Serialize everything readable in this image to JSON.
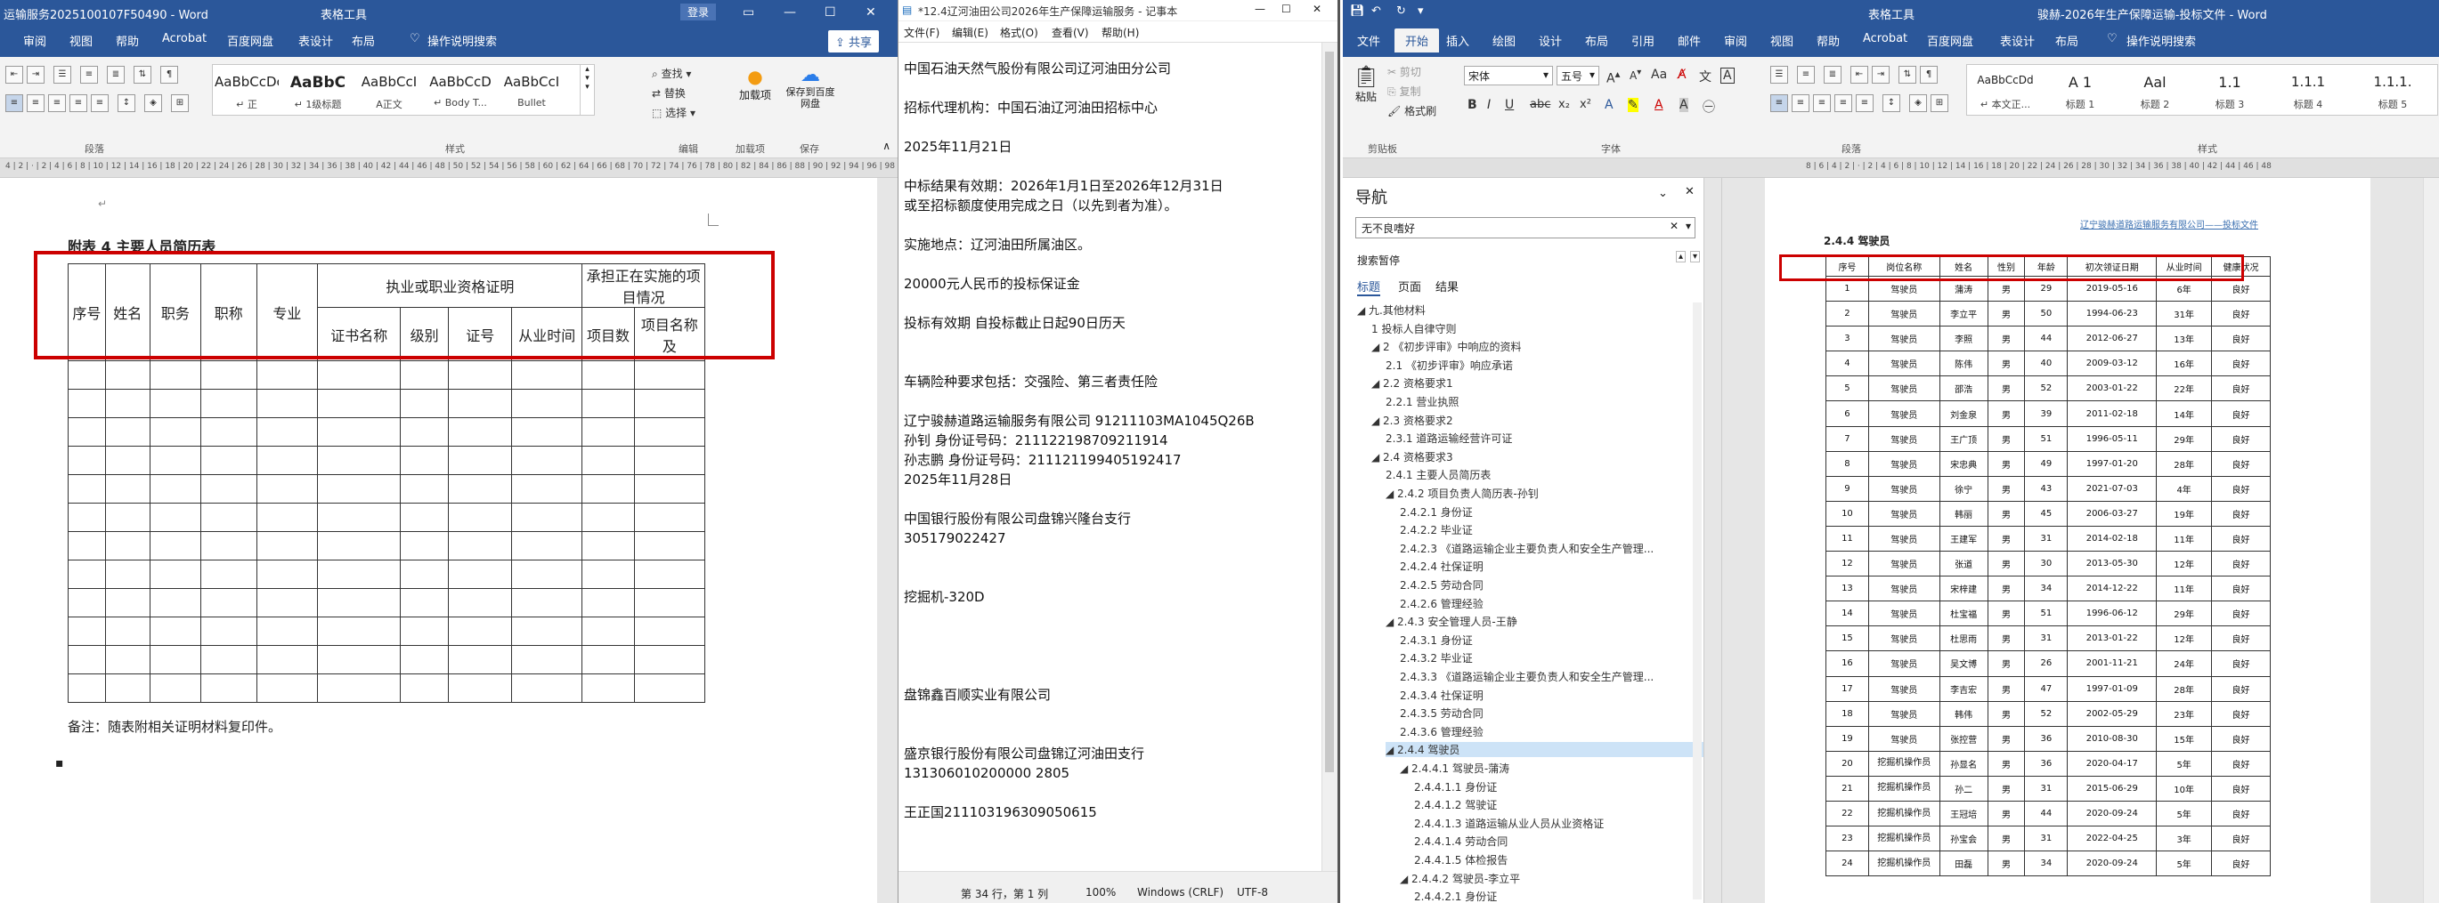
{
  "w1": {
    "title": "运输服务20251001­07F50490  -  Word",
    "title_short": "运输服务2025100107F50490 - Word",
    "tool_label": "表格工具",
    "login": "登录",
    "tabs": [
      "审阅",
      "视图",
      "帮助",
      "Acrobat",
      "百度网盘",
      "表设计",
      "布局"
    ],
    "tell_me": "操作说明搜索",
    "share": "共享",
    "styles": [
      {
        "sample": "AaBbCcDc",
        "name": "↵ 正"
      },
      {
        "sample": "AaBbC",
        "name": "↵ 1级标题"
      },
      {
        "sample": "AaBbCcI",
        "name": "A正文"
      },
      {
        "sample": "AaBbCcD",
        "name": "↵ Body T..."
      },
      {
        "sample": "AaBbCcI",
        "name": "Bullet"
      }
    ],
    "edit": {
      "find": "查找",
      "replace": "替换",
      "select": "选择"
    },
    "addin": "加载项",
    "save_baidu": "保存到百度网盘",
    "groups": {
      "para": "段落",
      "styles": "样式",
      "edit": "编辑",
      "addin": "加载项",
      "save": "保存"
    },
    "doc": {
      "caption": "附表 4  主要人员简历表",
      "headers": {
        "no": "序号",
        "name": "姓名",
        "post": "职务",
        "title": "职称",
        "major": "专业",
        "cert_group": "执业或职业资格证明",
        "cert_name": "证书名称",
        "level": "级别",
        "cert_no": "证号",
        "years": "从业时间",
        "proj_group": "承担正在实施的项目情况",
        "proj_count": "项目数",
        "proj_name": "项目名称及"
      },
      "note": "备注：随表附相关证明材料复印件。",
      "bullet": "▪"
    }
  },
  "w2": {
    "title": "*12.4辽河油田公司2026年生产保障运输服务 - 记事本",
    "menu": [
      "文件(F)",
      "编辑(E)",
      "格式(O)",
      "查看(V)",
      "帮助(H)"
    ],
    "lines": [
      "中国石油天然气股份有限公司辽河油田分公司",
      "",
      "招标代理机构：中国石油辽河油田招标中心",
      "",
      "2025年11月21日",
      "",
      "中标结果有效期：2026年1月1日至2026年12月31日",
      "或至招标额度使用完成之日（以先到者为准）。",
      "",
      "实施地点：辽河油田所属油区。",
      "",
      "20000元人民币的投标保证金",
      "",
      "投标有效期  自投标截止日起90日历天",
      "",
      "",
      "车辆险种要求包括：交强险、第三者责任险",
      "",
      "辽宁骏赫道路运输服务有限公司    91211103MA1045Q26B",
      "孙钊       身份证号码：211122198709211914",
      "孙志鹏     身份证号码：211121199405192417",
      "2025年11月28日",
      "",
      "中国银行股份有限公司盘锦兴隆台支行",
      "305179022427",
      "",
      "",
      "挖掘机-320D",
      "",
      "",
      "",
      "",
      "盘锦鑫百顺实业有限公司",
      "",
      "",
      "盛京银行股份有限公司盘锦辽河油田支行",
      "131306010200000 2805",
      "",
      "王正国211103196309050615"
    ],
    "status": {
      "pos": "第 34 行，第 1 列",
      "zoom": "100%",
      "eol": "Windows (CRLF)",
      "enc": "UTF-8"
    }
  },
  "w3": {
    "title": "骏赫-2026年生产保障运输-投标文件 - Word",
    "tool_label": "表格工具",
    "tabs": [
      "文件",
      "开始",
      "插入",
      "绘图",
      "设计",
      "布局",
      "引用",
      "邮件",
      "审阅",
      "视图",
      "帮助",
      "Acrobat",
      "百度网盘",
      "表设计",
      "布局"
    ],
    "tell_me": "操作说明搜索",
    "clipboard": {
      "paste": "粘贴",
      "cut": "剪切",
      "copy": "复制",
      "painter": "格式刷",
      "group": "剪贴板"
    },
    "font": {
      "name": "宋体",
      "size": "五号",
      "group": "字体"
    },
    "groups": {
      "para": "段落",
      "styles": "样式"
    },
    "styles": [
      {
        "sample": "AaBbCcDd",
        "name": "↵ 本文正..."
      },
      {
        "sample": "A 1",
        "name": "标题 1"
      },
      {
        "sample": "Aal",
        "name": "标题 2"
      },
      {
        "sample": "1.1",
        "name": "标题 3"
      },
      {
        "sample": "1.1.1",
        "name": "标题 4"
      },
      {
        "sample": "1.1.1.",
        "name": "标题 5"
      }
    ],
    "nav": {
      "title": "导航",
      "search_value": "无不良嗜好",
      "search_pause": "搜索暂停",
      "tabs": [
        "标题",
        "页面",
        "结果"
      ],
      "items": [
        "◢ 九.其他材料",
        "1 投标人自律守则",
        "◢ 2 《初步评审》中响应的资料",
        "2.1 《初步评审》响应承诺",
        "◢ 2.2 资格要求1",
        "2.2.1 营业执照",
        "◢ 2.3 资格要求2",
        "2.3.1 道路运输经营许可证",
        "◢ 2.4 资格要求3",
        "2.4.1 主要人员简历表",
        "◢ 2.4.2 项目负责人简历表-孙钊",
        "2.4.2.1 身份证",
        "2.4.2.2 毕业证",
        "2.4.2.3 《道路运输企业主要负责人和安全生产管理...",
        "2.4.2.4 社保证明",
        "2.4.2.5 劳动合同",
        "2.4.2.6 管理经验",
        "◢ 2.4.3 安全管理人员-王静",
        "2.4.3.1 身份证",
        "2.4.3.2 毕业证",
        "2.4.3.3 《道路运输企业主要负责人和安全生产管理...",
        "2.4.3.4 社保证明",
        "2.4.3.5 劳动合同",
        "2.4.3.6 管理经验",
        "◢ 2.4.4 驾驶员",
        "◢ 2.4.4.1 驾驶员-蒲涛",
        "2.4.4.1.1 身份证",
        "2.4.4.1.2 驾驶证",
        "2.4.4.1.3 道路运输从业人员从业资格证",
        "2.4.4.1.4 劳动合同",
        "2.4.4.1.5 体检报告",
        "◢ 2.4.4.2 驾驶员-李立平",
        "2.4.4.2.1 身份证"
      ]
    },
    "doc": {
      "header_text": "辽宁骏赫道路运输服务有限公司——投标文件",
      "heading": "2.4.4 驾驶员",
      "cols": [
        "序号",
        "岗位名称",
        "姓名",
        "性别",
        "年龄",
        "初次领证日期",
        "从业时间",
        "健康状况"
      ],
      "rows": [
        [
          "1",
          "驾驶员",
          "蒲涛",
          "男",
          "29",
          "2019-05-16",
          "6年",
          "良好"
        ],
        [
          "2",
          "驾驶员",
          "李立平",
          "男",
          "50",
          "1994-06-23",
          "31年",
          "良好"
        ],
        [
          "3",
          "驾驶员",
          "李照",
          "男",
          "44",
          "2012-06-27",
          "13年",
          "良好"
        ],
        [
          "4",
          "驾驶员",
          "陈伟",
          "男",
          "40",
          "2009-03-12",
          "16年",
          "良好"
        ],
        [
          "5",
          "驾驶员",
          "邵浩",
          "男",
          "52",
          "2003-01-22",
          "22年",
          "良好"
        ],
        [
          "6",
          "驾驶员",
          "刘金泉",
          "男",
          "39",
          "2011-02-18",
          "14年",
          "良好"
        ],
        [
          "7",
          "驾驶员",
          "王广顶",
          "男",
          "51",
          "1996-05-11",
          "29年",
          "良好"
        ],
        [
          "8",
          "驾驶员",
          "宋忠典",
          "男",
          "49",
          "1997-01-20",
          "28年",
          "良好"
        ],
        [
          "9",
          "驾驶员",
          "徐宁",
          "男",
          "43",
          "2021-07-03",
          "4年",
          "良好"
        ],
        [
          "10",
          "驾驶员",
          "韩丽",
          "男",
          "45",
          "2006-03-27",
          "19年",
          "良好"
        ],
        [
          "11",
          "驾驶员",
          "王建军",
          "男",
          "31",
          "2014-02-18",
          "11年",
          "良好"
        ],
        [
          "12",
          "驾驶员",
          "张道",
          "男",
          "30",
          "2013-05-30",
          "12年",
          "良好"
        ],
        [
          "13",
          "驾驶员",
          "宋梓建",
          "男",
          "34",
          "2014-12-22",
          "11年",
          "良好"
        ],
        [
          "14",
          "驾驶员",
          "杜宝福",
          "男",
          "51",
          "1996-06-12",
          "29年",
          "良好"
        ],
        [
          "15",
          "驾驶员",
          "杜思雨",
          "男",
          "31",
          "2013-01-22",
          "12年",
          "良好"
        ],
        [
          "16",
          "驾驶员",
          "吴文博",
          "男",
          "26",
          "2001-11-21",
          "24年",
          "良好"
        ],
        [
          "17",
          "驾驶员",
          "李吉宏",
          "男",
          "47",
          "1997-01-09",
          "28年",
          "良好"
        ],
        [
          "18",
          "驾驶员",
          "韩伟",
          "男",
          "52",
          "2002-05-29",
          "23年",
          "良好"
        ],
        [
          "19",
          "驾驶员",
          "张控营",
          "男",
          "36",
          "2010-08-30",
          "15年",
          "良好"
        ],
        [
          "20",
          "挖掘机操作员",
          "孙显名",
          "男",
          "36",
          "2020-04-17",
          "5年",
          "良好"
        ],
        [
          "21",
          "挖掘机操作员",
          "孙二",
          "男",
          "31",
          "2015-06-29",
          "10年",
          "良好"
        ],
        [
          "22",
          "挖掘机操作员",
          "王冠培",
          "男",
          "44",
          "2020-09-24",
          "5年",
          "良好"
        ],
        [
          "23",
          "挖掘机操作员",
          "孙宝会",
          "男",
          "31",
          "2022-04-25",
          "3年",
          "良好"
        ],
        [
          "24",
          "挖掘机操作员",
          "田磊",
          "男",
          "34",
          "2020-09-24",
          "5年",
          "良好"
        ]
      ]
    }
  },
  "colors": {
    "word_blue": "#2b579a",
    "highlight_red": "#cc0000",
    "nav_select": "#cde3f7"
  }
}
